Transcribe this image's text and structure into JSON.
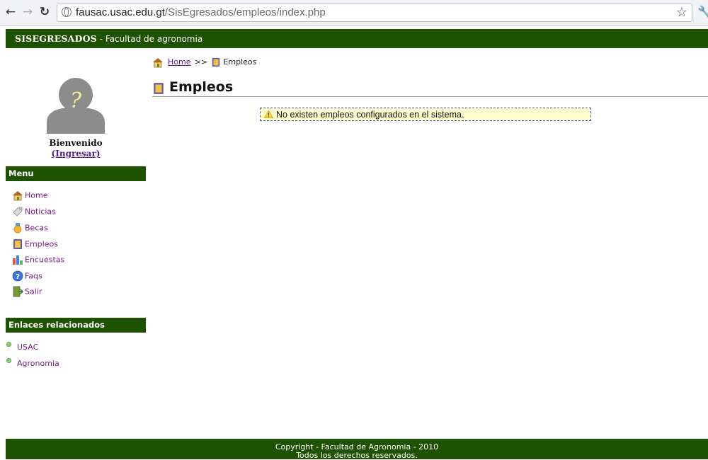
{
  "browser": {
    "url_domain": "fausac.usac.edu.gt",
    "url_path": "/SisEgresados/empleos/index.php",
    "back_icon": "back-arrow-icon",
    "forward_icon": "forward-arrow-icon",
    "reload_icon": "reload-icon",
    "bookmark_icon": "star-icon",
    "menu_icon": "wrench-icon"
  },
  "header": {
    "brand_name": "SISEGRESADOS",
    "brand_suffix": "- Facultad de agronomia"
  },
  "user": {
    "welcome": "Bienvenido",
    "login_link": "(Ingresar)"
  },
  "sidebar": {
    "menu_title": "Menu",
    "items": [
      {
        "label": "Home",
        "icon": "home-icon"
      },
      {
        "label": "Noticias",
        "icon": "tag-icon"
      },
      {
        "label": "Becas",
        "icon": "medal-icon"
      },
      {
        "label": "Empleos",
        "icon": "briefcase-icon"
      },
      {
        "label": "Encuestas",
        "icon": "chart-icon"
      },
      {
        "label": "Faqs",
        "icon": "help-icon"
      },
      {
        "label": "Salir",
        "icon": "exit-icon"
      }
    ],
    "links_title": "Enlaces relacionados",
    "links": [
      {
        "label": "USAC"
      },
      {
        "label": "Agronomia"
      }
    ]
  },
  "breadcrumb": {
    "home": "Home",
    "separator": ">>",
    "current": "Empleos"
  },
  "main": {
    "title": "Empleos",
    "message": "No existen empleos configurados en el sistema."
  },
  "footer": {
    "line1": "Copyright - Facultad de Agronomia - 2010",
    "line2": "Todos los derechos reservados."
  },
  "colors": {
    "brand_green": "#1e5200",
    "link_purple": "#7a1a8c",
    "message_bg": "#ffffd0",
    "message_border": "#3d4db0"
  }
}
